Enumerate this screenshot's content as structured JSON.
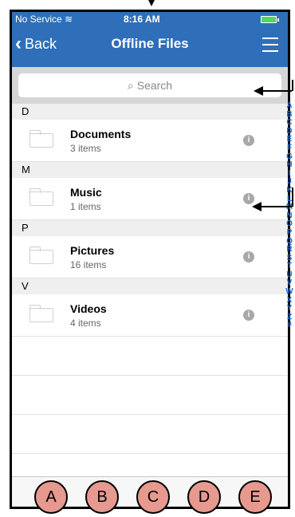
{
  "status_bar": {
    "carrier": "No Service",
    "time": "8:16 AM"
  },
  "nav": {
    "back_label": "Back",
    "title": "Offline Files"
  },
  "search": {
    "placeholder": "Search"
  },
  "sections": [
    {
      "letter": "D",
      "items": [
        {
          "name": "Documents",
          "count": "3 items"
        }
      ]
    },
    {
      "letter": "M",
      "items": [
        {
          "name": "Music",
          "count": "1 items"
        }
      ]
    },
    {
      "letter": "P",
      "items": [
        {
          "name": "Pictures",
          "count": "16 items"
        }
      ]
    },
    {
      "letter": "V",
      "items": [
        {
          "name": "Videos",
          "count": "4 items"
        }
      ]
    }
  ],
  "index_letters": [
    "A",
    "B",
    "C",
    "D",
    "E",
    "F",
    "G",
    "H",
    "I",
    "J",
    "K",
    "L",
    "M",
    "N",
    "O",
    "P",
    "Q",
    "R",
    "S",
    "T",
    "U",
    "V",
    "W",
    "X",
    "Y",
    "Z",
    "#"
  ],
  "toolbar": {
    "icons": [
      "select-icon",
      "folder-add-icon",
      "grid-icon",
      "sort-icon",
      "refresh-icon"
    ]
  },
  "markers": [
    "A",
    "B",
    "C",
    "D",
    "E"
  ],
  "colors": {
    "primary": "#2f6fb9",
    "marker_fill": "#e6998f",
    "index_text": "#1e6ed6"
  }
}
